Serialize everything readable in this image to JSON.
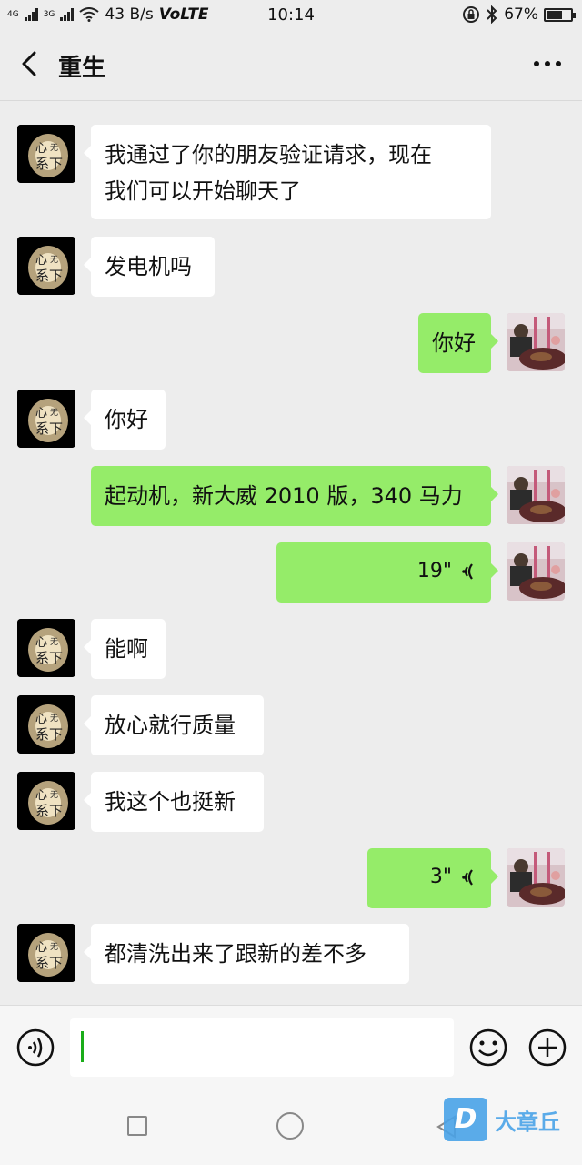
{
  "status_bar": {
    "net_top": "4G",
    "net_bottom": "3G",
    "speed": "43 B/s",
    "volte": "VoLTE",
    "time": "10:14",
    "battery": "67%",
    "battery_level": 0.67
  },
  "header": {
    "title": "重生",
    "back_icon": "chevron-left-icon",
    "more_icon": "more-dots-icon"
  },
  "messages": [
    {
      "side": "in",
      "text": "我通过了你的朋友验证请求，现在\n我们可以开始聊天了"
    },
    {
      "side": "in",
      "text": "发电机吗"
    },
    {
      "side": "out",
      "text": "你好"
    },
    {
      "side": "in",
      "text": "你好"
    },
    {
      "side": "out",
      "text": "起动机，新大威 2010 版，340 马力"
    },
    {
      "side": "out",
      "type": "voice",
      "text": "19\""
    },
    {
      "side": "in",
      "text": "能啊"
    },
    {
      "side": "in",
      "text": "放心就行质量"
    },
    {
      "side": "in",
      "text": "我这个也挺新"
    },
    {
      "side": "out",
      "type": "voice",
      "text": "3\""
    },
    {
      "side": "in",
      "text": "都清洗出来了跟新的差不多"
    }
  ],
  "input_bar": {
    "voice_icon": "voice-mode-icon",
    "emoji_icon": "emoji-icon",
    "plus_icon": "plus-icon"
  },
  "watermark": {
    "logo": "D",
    "text": "大章丘"
  },
  "colors": {
    "outgoing_bubble": "#95ec69",
    "incoming_bubble": "#ffffff",
    "background": "#ededed",
    "cursor": "#1aad19"
  }
}
